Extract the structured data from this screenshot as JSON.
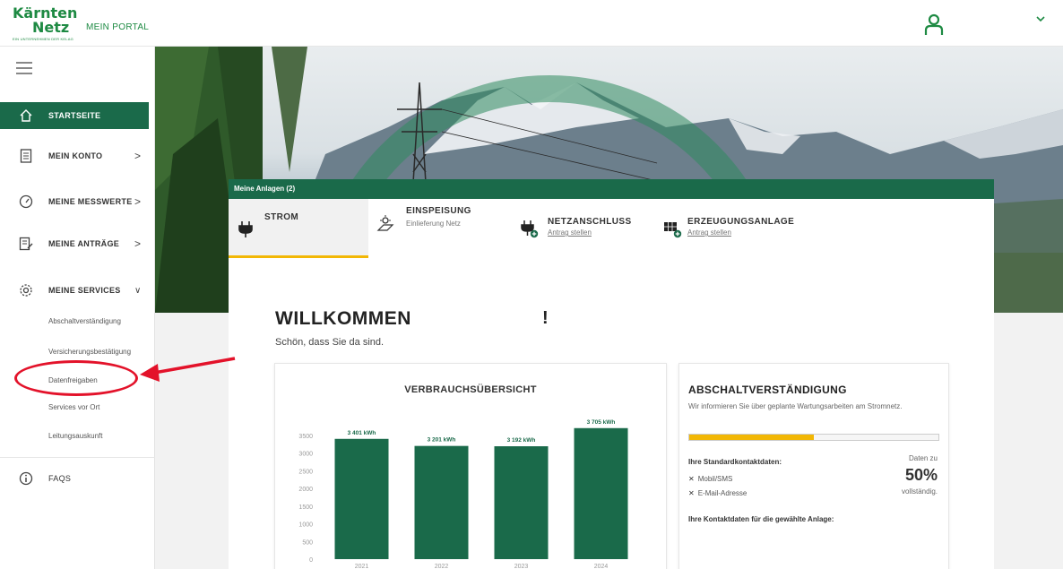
{
  "brand": {
    "line1": "Kärnten",
    "line2": "Netz",
    "tagline": "EIN UNTERNEHMEN DER KELAG",
    "portal": "MEIN PORTAL"
  },
  "sidebar": {
    "items": [
      {
        "label": "STARTSEITE",
        "icon": "home-icon",
        "active": true
      },
      {
        "label": "MEIN KONTO",
        "icon": "document-icon",
        "chevron": ">"
      },
      {
        "label": "MEINE MESSWERTE",
        "icon": "gauge-icon",
        "chevron": ">"
      },
      {
        "label": "MEINE ANTRÄGE",
        "icon": "form-icon",
        "chevron": ">"
      },
      {
        "label": "MEINE SERVICES",
        "icon": "gear-icon",
        "chevron": "∨"
      }
    ],
    "subitems": [
      "Abschaltverständigung",
      "Versicherungsbestätigung",
      "Datenfreigaben",
      "Services vor Ort",
      "Leitungsauskunft"
    ],
    "faq": {
      "label": "FAQS",
      "icon": "info-icon"
    }
  },
  "panel": {
    "header": "Meine Anlagen (2)",
    "tabs": [
      {
        "title": "STROM",
        "sub": "",
        "icon": "plug-icon"
      },
      {
        "title": "EINSPEISUNG",
        "sub": "Einlieferung Netz",
        "icon": "solar-icon"
      },
      {
        "title": "NETZANSCHLUSS",
        "sub": "Antrag stellen",
        "icon": "plug-plus-icon"
      },
      {
        "title": "ERZEUGUNGSANLAGE",
        "sub": "Antrag stellen",
        "icon": "solar-plus-icon"
      }
    ]
  },
  "welcome": {
    "title": "WILLKOMMEN",
    "exclamation": "!",
    "greeting": "Schön, dass Sie da sind."
  },
  "usage": {
    "title": "VERBRAUCHSÜBERSICHT"
  },
  "chart_data": {
    "type": "bar",
    "title": "VERBRAUCHSÜBERSICHT",
    "categories": [
      "2021",
      "2022",
      "2023",
      "2024"
    ],
    "values": [
      3401,
      3201,
      3192,
      3705
    ],
    "data_labels": [
      "3 401 kWh",
      "3 201 kWh",
      "3 192 kWh",
      "3 705 kWh"
    ],
    "yticks": [
      0,
      500,
      1000,
      1500,
      2000,
      2500,
      3000,
      3500
    ],
    "ylim": [
      0,
      3750
    ],
    "grid": false,
    "bar_color": "#1a6a4a"
  },
  "abschalt": {
    "title": "ABSCHALTVERSTÄNDIGUNG",
    "desc": "Wir informieren Sie über geplante Wartungsarbeiten am Stromnetz.",
    "progress": 0.5,
    "contact_label": "Ihre Standardkontaktdaten:",
    "contacts": [
      "Mobil/SMS",
      "E-Mail-Adresse"
    ],
    "x_mark": "✕",
    "completeness_pre": "Daten zu",
    "completeness_value": "50%",
    "completeness_post": "vollständig.",
    "plant_contact_label": "Ihre Kontaktdaten für die gewählte Anlage:"
  },
  "colors": {
    "brand_green": "#1a6a4a",
    "accent": "#f2b705",
    "highlight": "#e3122a"
  }
}
